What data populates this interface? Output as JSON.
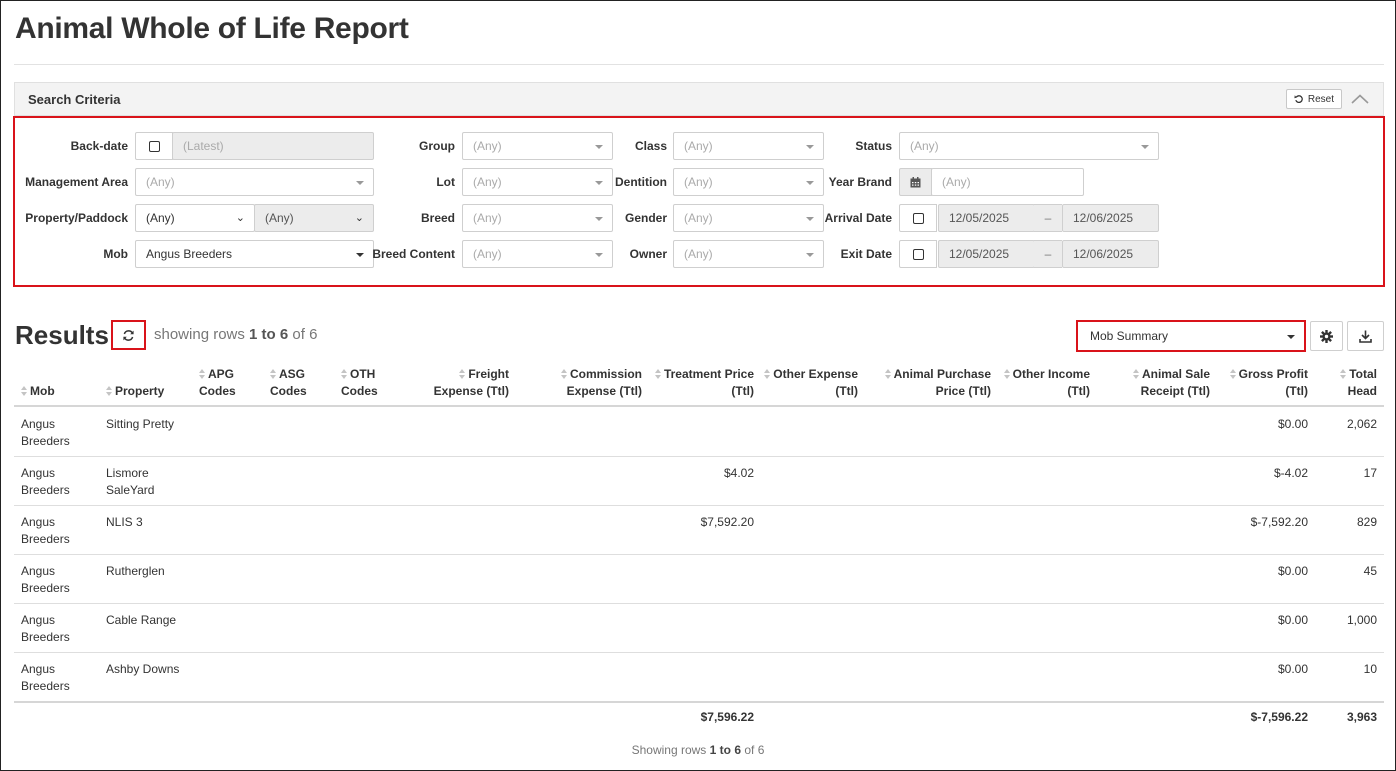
{
  "page": {
    "title": "Animal Whole of Life Report"
  },
  "search": {
    "title": "Search Criteria",
    "reset_label": "Reset",
    "labels": {
      "backdate": "Back-date",
      "management_area": "Management Area",
      "property_paddock": "Property/Paddock",
      "mob": "Mob",
      "group": "Group",
      "lot": "Lot",
      "breed": "Breed",
      "breed_content": "Breed Content",
      "class": "Class",
      "dentition": "Dentition",
      "gender": "Gender",
      "owner": "Owner",
      "status": "Status",
      "year_brand": "Year Brand",
      "arrival_date": "Arrival Date",
      "exit_date": "Exit Date"
    },
    "values": {
      "backdate": "(Latest)",
      "management_area": "(Any)",
      "property": "(Any)",
      "paddock": "(Any)",
      "mob": "Angus Breeders",
      "group": "(Any)",
      "lot": "(Any)",
      "breed": "(Any)",
      "breed_content": "(Any)",
      "class": "(Any)",
      "dentition": "(Any)",
      "gender": "(Any)",
      "owner": "(Any)",
      "status": "(Any)",
      "year_brand": "(Any)",
      "arrival_from": "12/05/2025",
      "arrival_to": "12/06/2025",
      "exit_from": "12/05/2025",
      "exit_to": "12/06/2025",
      "date_separator": "–"
    }
  },
  "results": {
    "title": "Results",
    "showing_prefix": "showing rows",
    "range": "1 to 6",
    "of_word": "of",
    "total": "6",
    "view_select": "Mob Summary",
    "columns": [
      {
        "l1": "",
        "l2": "Mob"
      },
      {
        "l1": "",
        "l2": "Property"
      },
      {
        "l1": "APG",
        "l2": "Codes"
      },
      {
        "l1": "ASG",
        "l2": "Codes"
      },
      {
        "l1": "OTH",
        "l2": "Codes"
      },
      {
        "l1": "Freight",
        "l2": "Expense (Ttl)"
      },
      {
        "l1": "Commission",
        "l2": "Expense (Ttl)"
      },
      {
        "l1": "Treatment Price",
        "l2": "(Ttl)"
      },
      {
        "l1": "Other Expense",
        "l2": "(Ttl)"
      },
      {
        "l1": "Animal Purchase",
        "l2": "Price (Ttl)"
      },
      {
        "l1": "Other Income",
        "l2": "(Ttl)"
      },
      {
        "l1": "Animal Sale",
        "l2": "Receipt (Ttl)"
      },
      {
        "l1": "Gross Profit",
        "l2": "(Ttl)"
      },
      {
        "l1": "Total",
        "l2": "Head"
      }
    ],
    "rows": [
      {
        "mob1": "Angus",
        "mob2": "Breeders",
        "prop1": "Sitting Pretty",
        "prop2": "",
        "treatment": "",
        "gross": "$0.00",
        "head": "2,062"
      },
      {
        "mob1": "Angus",
        "mob2": "Breeders",
        "prop1": "Lismore",
        "prop2": "SaleYard",
        "treatment": "$4.02",
        "gross": "$-4.02",
        "head": "17"
      },
      {
        "mob1": "Angus",
        "mob2": "Breeders",
        "prop1": "NLIS 3",
        "prop2": "",
        "treatment": "$7,592.20",
        "gross": "$-7,592.20",
        "head": "829"
      },
      {
        "mob1": "Angus",
        "mob2": "Breeders",
        "prop1": "Rutherglen",
        "prop2": "",
        "treatment": "",
        "gross": "$0.00",
        "head": "45"
      },
      {
        "mob1": "Angus",
        "mob2": "Breeders",
        "prop1": "Cable Range",
        "prop2": "",
        "treatment": "",
        "gross": "$0.00",
        "head": "1,000"
      },
      {
        "mob1": "Angus",
        "mob2": "Breeders",
        "prop1": "Ashby Downs",
        "prop2": "",
        "treatment": "",
        "gross": "$0.00",
        "head": "10"
      }
    ],
    "totals": {
      "treatment": "$7,596.22",
      "gross": "$-7,596.22",
      "head": "3,963"
    },
    "footer": {
      "prefix": "Showing rows",
      "range": "1 to 6",
      "of_word": "of",
      "total": "6"
    }
  }
}
